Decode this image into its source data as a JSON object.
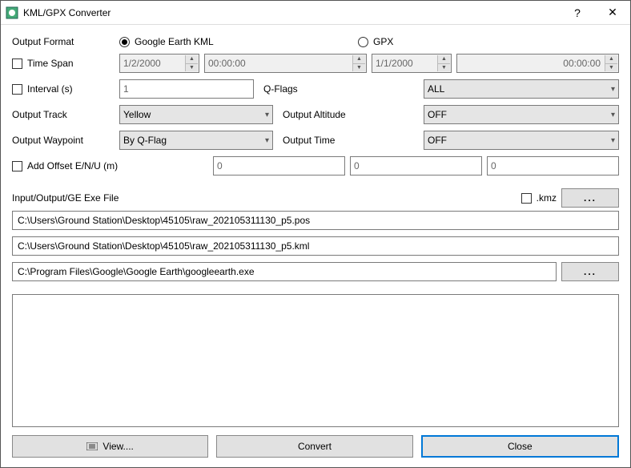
{
  "window": {
    "title": "KML/GPX Converter",
    "help": "?",
    "close": "✕"
  },
  "outputFormat": {
    "label": "Output Format",
    "opt1": "Google Earth KML",
    "opt2": "GPX",
    "selected": 1
  },
  "timeSpan": {
    "label": "Time Span",
    "date1": "1/2/2000",
    "time1": "00:00:00",
    "date2": "1/1/2000",
    "time2": "00:00:00"
  },
  "interval": {
    "label": "Interval (s)",
    "value": "1"
  },
  "qflags": {
    "label": "Q-Flags",
    "value": "ALL"
  },
  "outputTrack": {
    "label": "Output Track",
    "value": "Yellow"
  },
  "outputAltitude": {
    "label": "Output Altitude",
    "value": "OFF"
  },
  "outputWaypoint": {
    "label": "Output Waypoint",
    "value": "By Q-Flag"
  },
  "outputTime": {
    "label": "Output Time",
    "value": "OFF"
  },
  "offset": {
    "label": "Add Offset E/N/U (m)",
    "e": "0",
    "n": "0",
    "u": "0"
  },
  "io": {
    "label": "Input/Output/GE Exe File",
    "kmz": ".kmz",
    "browse": "...",
    "input": "C:\\Users\\Ground Station\\Desktop\\45105\\raw_202105311130_p5.pos",
    "output": "C:\\Users\\Ground Station\\Desktop\\45105\\raw_202105311130_p5.kml",
    "exe": "C:\\Program Files\\Google\\Google Earth\\googleearth.exe"
  },
  "buttons": {
    "view": "View....",
    "convert": "Convert",
    "close": "Close"
  }
}
